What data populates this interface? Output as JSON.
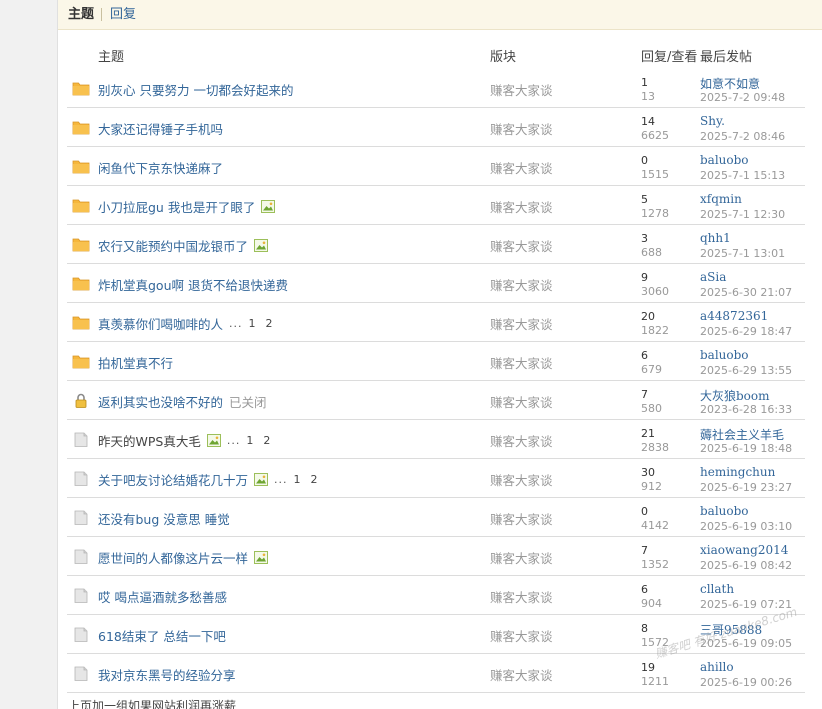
{
  "tabs": {
    "active": "主题",
    "other": "回复"
  },
  "headers": {
    "subject": "主题",
    "forum": "版块",
    "stats": "回复/查看",
    "last": "最后发帖"
  },
  "threads": [
    {
      "title": "别灰心 只要努力 一切都会好起来的",
      "forum": "赚客大家谈",
      "replies": "1",
      "views": "13",
      "last_user": "如意不如意",
      "last_time": "2025-7-2 09:48",
      "icon": "folder"
    },
    {
      "title": "大家还记得锤子手机吗",
      "forum": "赚客大家谈",
      "replies": "14",
      "views": "6625",
      "last_user": "Shy.",
      "last_time": "2025-7-2 08:46",
      "icon": "folder"
    },
    {
      "title": "闲鱼代下京东快递麻了",
      "forum": "赚客大家谈",
      "replies": "0",
      "views": "1515",
      "last_user": "baluobo",
      "last_time": "2025-7-1 15:13",
      "icon": "folder"
    },
    {
      "title": "小刀拉屁gu 我也是开了眼了",
      "forum": "赚客大家谈",
      "replies": "5",
      "views": "1278",
      "last_user": "xfqmin",
      "last_time": "2025-7-1 12:30",
      "icon": "folder",
      "has_image": true
    },
    {
      "title": "农行又能预约中国龙银币了",
      "forum": "赚客大家谈",
      "replies": "3",
      "views": "688",
      "last_user": "qhh1",
      "last_time": "2025-7-1 13:01",
      "icon": "folder",
      "has_image": true
    },
    {
      "title": "炸机堂真gou啊 退货不给退快递费",
      "forum": "赚客大家谈",
      "replies": "9",
      "views": "3060",
      "last_user": "aSia",
      "last_time": "2025-6-30 21:07",
      "icon": "folder"
    },
    {
      "title": "真羡慕你们喝咖啡的人",
      "forum": "赚客大家谈",
      "replies": "20",
      "views": "1822",
      "last_user": "a44872361",
      "last_time": "2025-6-29 18:47",
      "icon": "folder",
      "pages": {
        "dots": "...",
        "p1": "1",
        "p2": "2"
      }
    },
    {
      "title": "拍机堂真不行",
      "forum": "赚客大家谈",
      "replies": "6",
      "views": "679",
      "last_user": "baluobo",
      "last_time": "2025-6-29 13:55",
      "icon": "folder"
    },
    {
      "title": "返利其实也没啥不好的",
      "closed": "已关闭",
      "forum": "赚客大家谈",
      "replies": "7",
      "views": "580",
      "last_user": "大灰狼boom",
      "last_time": "2023-6-28 16:33",
      "icon": "lock"
    },
    {
      "title": "昨天的WPS真大毛",
      "forum": "赚客大家谈",
      "replies": "21",
      "views": "2838",
      "last_user": "薅社会主义羊毛",
      "last_time": "2025-6-19 18:48",
      "icon": "doc",
      "dark": true,
      "has_image": true,
      "pages": {
        "dots": "...",
        "p1": "1",
        "p2": "2"
      }
    },
    {
      "title": "关于吧友讨论结婚花几十万",
      "forum": "赚客大家谈",
      "replies": "30",
      "views": "912",
      "last_user": "hemingchun",
      "last_time": "2025-6-19 23:27",
      "icon": "doc",
      "has_image": true,
      "pages": {
        "dots": "...",
        "p1": "1",
        "p2": "2"
      }
    },
    {
      "title": "还没有bug 没意思 睡觉",
      "forum": "赚客大家谈",
      "replies": "0",
      "views": "4142",
      "last_user": "baluobo",
      "last_time": "2025-6-19 03:10",
      "icon": "doc"
    },
    {
      "title": "愿世间的人都像这片云一样",
      "forum": "赚客大家谈",
      "replies": "7",
      "views": "1352",
      "last_user": "xiaowang2014",
      "last_time": "2025-6-19 08:42",
      "icon": "doc",
      "has_image": true
    },
    {
      "title": "哎 喝点逼酒就多愁善感",
      "forum": "赚客大家谈",
      "replies": "6",
      "views": "904",
      "last_user": "cllath",
      "last_time": "2025-6-19 07:21",
      "icon": "doc"
    },
    {
      "title": "618结束了 总结一下吧",
      "forum": "赚客大家谈",
      "replies": "8",
      "views": "1572",
      "last_user": "三哥95888",
      "last_time": "2025-6-19 09:05",
      "icon": "doc"
    },
    {
      "title": "我对京东黑号的经验分享",
      "forum": "赚客大家谈",
      "replies": "19",
      "views": "1211",
      "last_user": "ahillo",
      "last_time": "2025-6-19 00:26",
      "icon": "doc"
    }
  ],
  "footer": "上页加一组如果网站利润再涨薪",
  "watermark": "赚客吧 有好 zuanke8.com",
  "colors": {
    "link": "#336699",
    "muted": "#999999",
    "folder": "#f6b73c",
    "tabbar_bg": "#fbf7e8"
  }
}
